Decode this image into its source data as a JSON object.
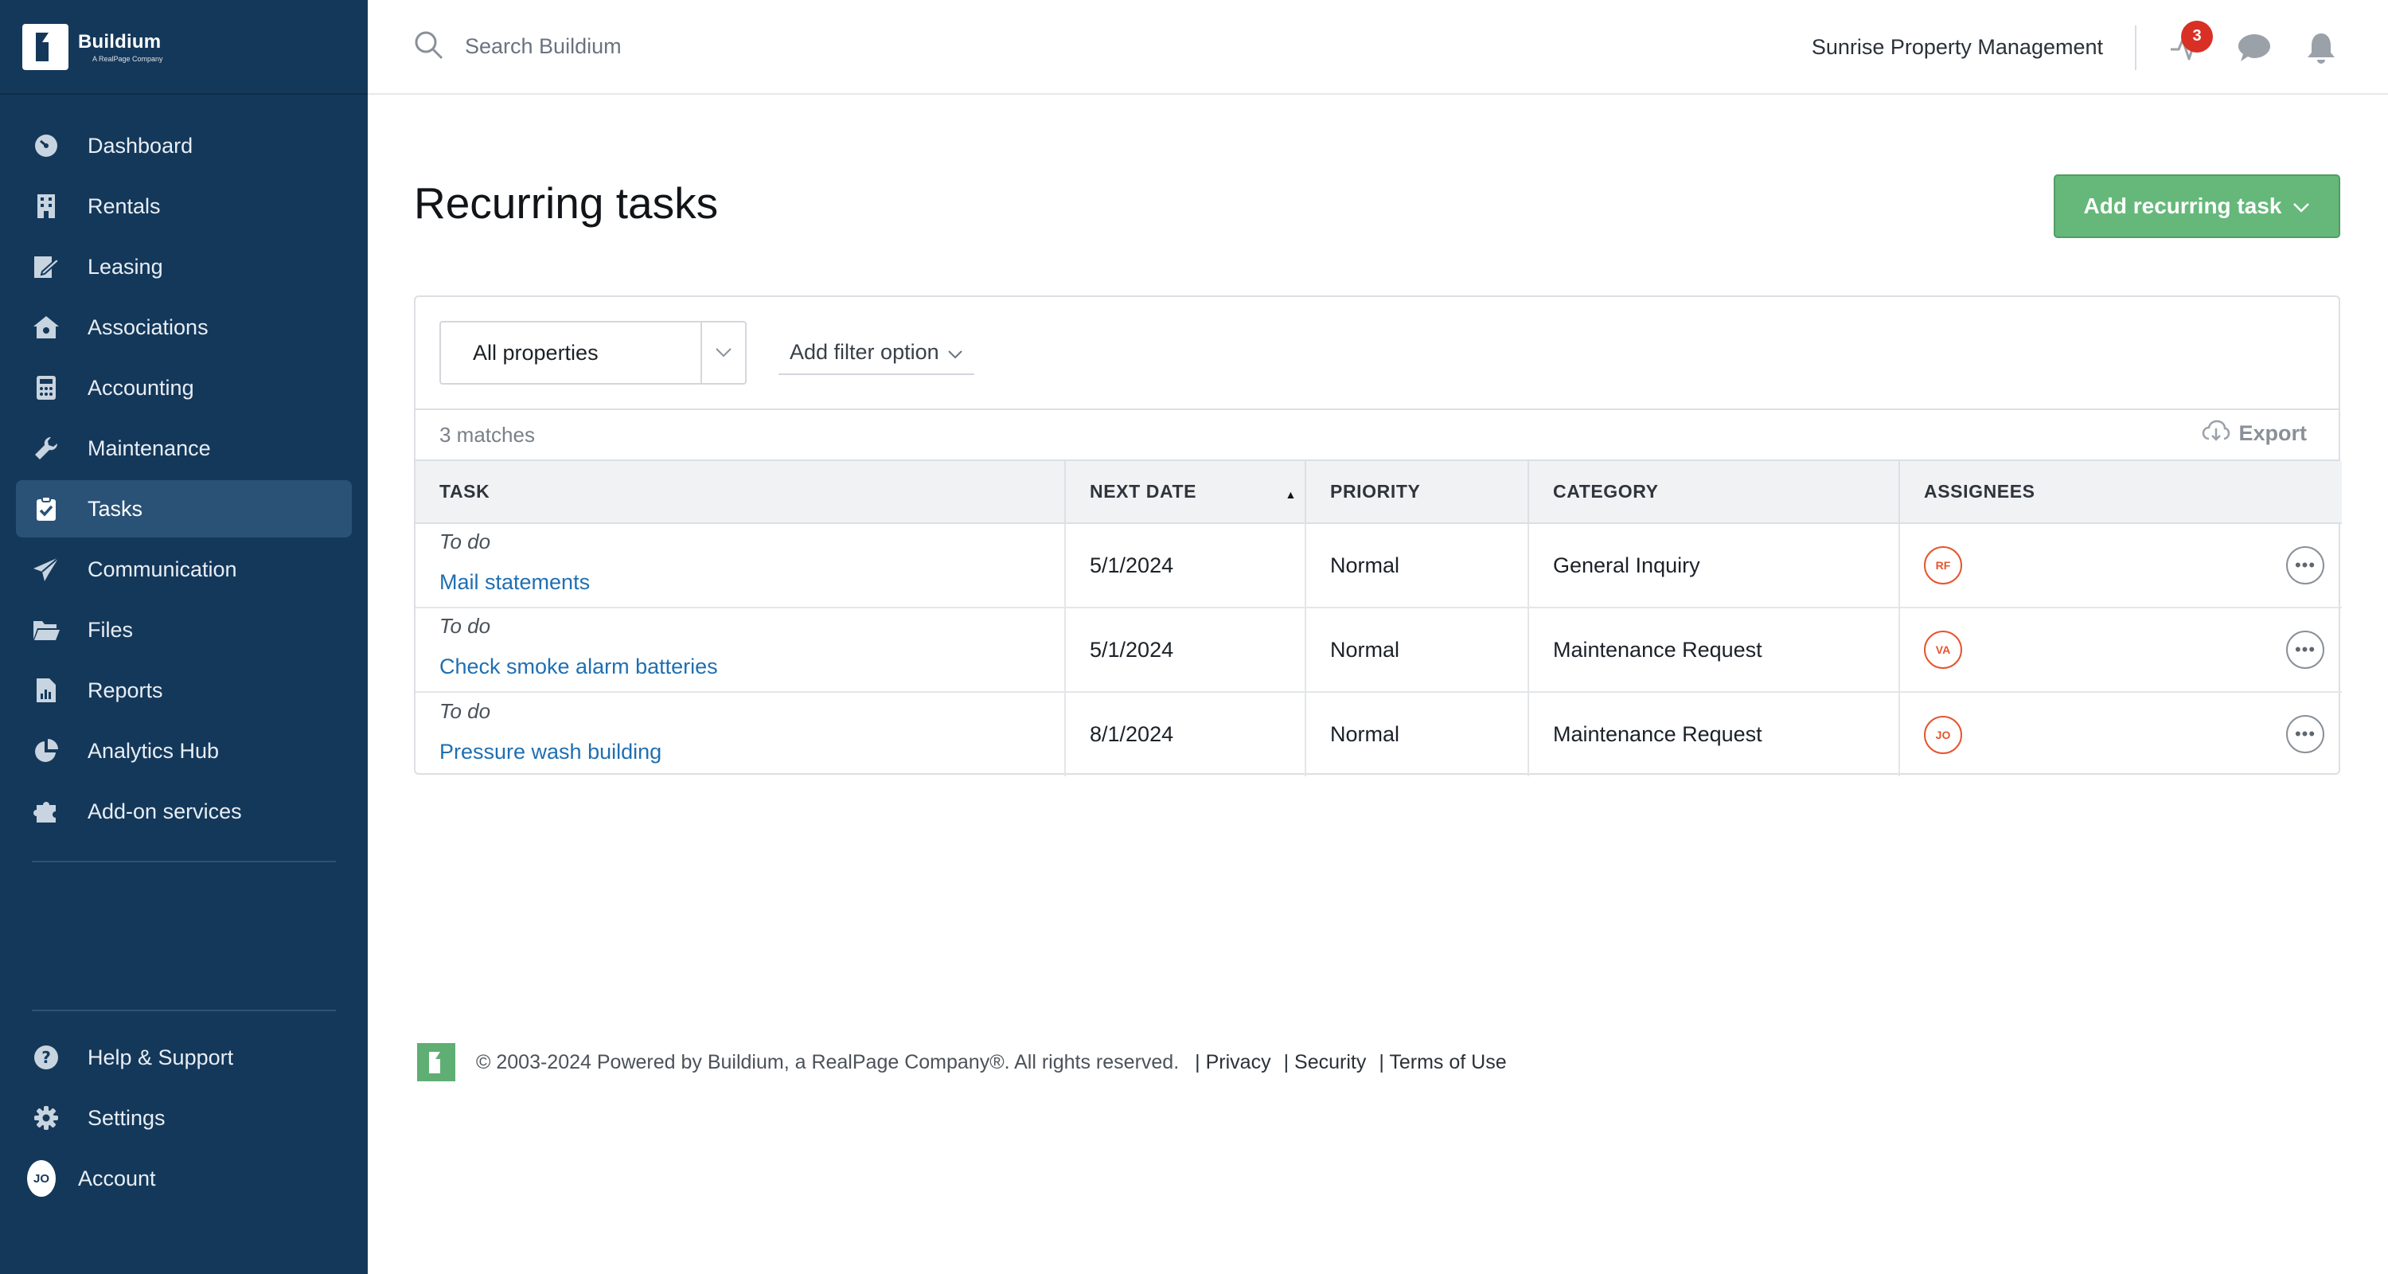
{
  "app": {
    "brand_name": "Buildium",
    "brand_sub": "A RealPage Company"
  },
  "sidebar": {
    "items": [
      {
        "label": "Dashboard",
        "icon": "dashboard-icon"
      },
      {
        "label": "Rentals",
        "icon": "building-icon"
      },
      {
        "label": "Leasing",
        "icon": "lease-icon"
      },
      {
        "label": "Associations",
        "icon": "association-icon"
      },
      {
        "label": "Accounting",
        "icon": "calculator-icon"
      },
      {
        "label": "Maintenance",
        "icon": "wrench-icon"
      },
      {
        "label": "Tasks",
        "icon": "clipboard-check-icon",
        "active": true
      },
      {
        "label": "Communication",
        "icon": "paper-plane-icon"
      },
      {
        "label": "Files",
        "icon": "folder-icon"
      },
      {
        "label": "Reports",
        "icon": "report-icon"
      },
      {
        "label": "Analytics Hub",
        "icon": "pie-chart-icon"
      },
      {
        "label": "Add-on services",
        "icon": "puzzle-icon"
      }
    ],
    "bottom": {
      "help": "Help & Support",
      "settings": "Settings",
      "account": "Account",
      "account_initials": "JO"
    }
  },
  "topbar": {
    "search_placeholder": "Search Buildium",
    "company": "Sunrise Property Management",
    "activity_badge": "3"
  },
  "page": {
    "title": "Recurring tasks",
    "add_button": "Add recurring task"
  },
  "filters": {
    "property_select": "All properties",
    "add_filter": "Add filter option"
  },
  "results": {
    "matches": "3 matches",
    "export": "Export"
  },
  "table": {
    "headers": {
      "task": "TASK",
      "next_date": "NEXT DATE",
      "priority": "PRIORITY",
      "category": "CATEGORY",
      "assignees": "ASSIGNEES"
    },
    "rows": [
      {
        "status": "To do",
        "task": "Mail statements",
        "next_date": "5/1/2024",
        "priority": "Normal",
        "category": "General Inquiry",
        "assignee": "RF"
      },
      {
        "status": "To do",
        "task": "Check smoke alarm batteries",
        "next_date": "5/1/2024",
        "priority": "Normal",
        "category": "Maintenance Request",
        "assignee": "VA"
      },
      {
        "status": "To do",
        "task": "Pressure wash building",
        "next_date": "8/1/2024",
        "priority": "Normal",
        "category": "Maintenance Request",
        "assignee": "JO"
      }
    ]
  },
  "footer": {
    "copyright": "© 2003-2024 Powered by Buildium, a RealPage Company®. All rights reserved.",
    "privacy": "Privacy",
    "security": "Security",
    "terms": "Terms of Use"
  },
  "colors": {
    "sidebar_bg": "#14385a",
    "sidebar_active": "#2a5276",
    "primary_button": "#66b87a",
    "link": "#1f6fb2",
    "badge": "#d93025",
    "assignee": "#e5552f"
  }
}
